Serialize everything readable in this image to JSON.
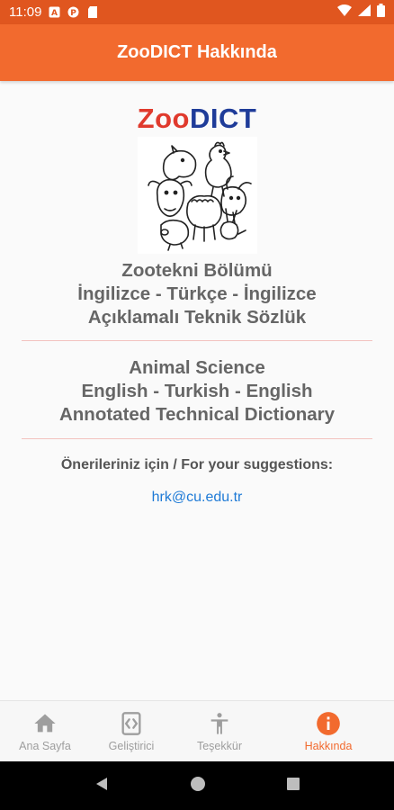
{
  "status_bar": {
    "time": "11:09",
    "icons_left": [
      "a-icon",
      "p-icon",
      "sd-card-icon"
    ],
    "icons_right": [
      "wifi-icon",
      "signal-icon",
      "battery-icon"
    ]
  },
  "app_bar": {
    "title": "ZooDICT Hakkında"
  },
  "logo": {
    "zoo": "Zoo",
    "dict": "DICT"
  },
  "turkish_block": {
    "line1": "Zootekni Bölümü",
    "line2": "İngilizce - Türkçe - İngilizce",
    "line3": "Açıklamalı Teknik Sözlük"
  },
  "english_block": {
    "line1": "Animal Science",
    "line2": "English - Turkish - English",
    "line3": "Annotated  Technical Dictionary"
  },
  "suggestions": {
    "label": "Önerileriniz için / For your suggestions:",
    "email": "hrk@cu.edu.tr"
  },
  "bottom_nav": {
    "items": [
      {
        "label": "Ana Sayfa",
        "icon": "home-icon"
      },
      {
        "label": "Geliştirici",
        "icon": "code-icon"
      },
      {
        "label": "Teşekkür",
        "icon": "person-icon"
      },
      {
        "label": "Hakkında",
        "icon": "info-icon"
      }
    ],
    "active_index": 3
  },
  "colors": {
    "app_bar": "#f26a2e",
    "status_bar": "#e0561f",
    "accent": "#f26a2e",
    "link": "#1e7ad6"
  }
}
